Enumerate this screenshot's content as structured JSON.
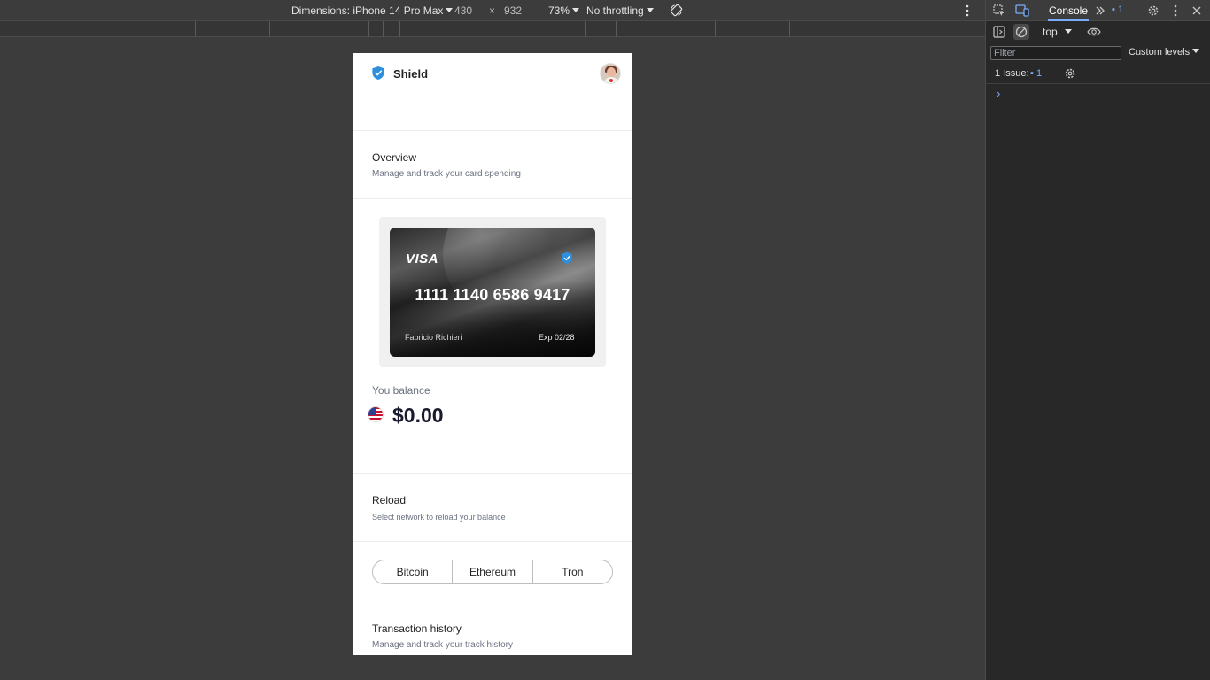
{
  "device_toolbar": {
    "dimensions_label": "Dimensions: iPhone 14 Pro Max",
    "width": "430",
    "times": "×",
    "height": "932",
    "zoom": "73%",
    "throttling": "No throttling",
    "rotate_icon": "rotate-icon",
    "more_icon": "more-vert-icon"
  },
  "devtools": {
    "tab_console": "Console",
    "badge_count": "1",
    "context": "top",
    "filter_placeholder": "Filter",
    "levels": "Custom levels",
    "issues_label": "1 Issue:",
    "issues_count": "1",
    "prompt": "›"
  },
  "app": {
    "brand": "Shield",
    "overview": {
      "title": "Overview",
      "subtitle": "Manage and track your card spending"
    },
    "card": {
      "network": "VISA",
      "number": "1111 1140 6586 9417",
      "holder": "Fabricio Richieri",
      "expiry": "Exp 02/28"
    },
    "balance": {
      "label": "You balance",
      "value": "$0.00"
    },
    "reload": {
      "title": "Reload",
      "subtitle": "Select network to reload your balance",
      "networks": [
        "Bitcoin",
        "Ethereum",
        "Tron"
      ]
    },
    "history": {
      "title": "Transaction history",
      "subtitle": "Manage and track your track history"
    }
  },
  "colors": {
    "accent_blue": "#2d8fdd",
    "devtools_blue": "#7cacf8"
  }
}
